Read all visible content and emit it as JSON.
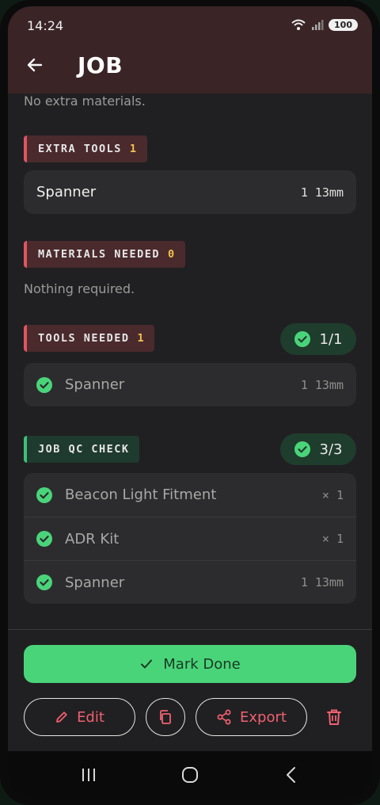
{
  "status": {
    "time": "14:24",
    "battery": "100"
  },
  "header": {
    "title": "JOB"
  },
  "extra_materials": {
    "empty_text": "No extra materials."
  },
  "extra_tools": {
    "label": "EXTRA TOOLS",
    "count": "1",
    "items": [
      {
        "name": "Spanner",
        "qty": "1 13mm"
      }
    ]
  },
  "materials_needed": {
    "label": "MATERIALS NEEDED",
    "count": "0",
    "empty_text": "Nothing required."
  },
  "tools_needed": {
    "label": "TOOLS NEEDED",
    "count": "1",
    "progress": "1/1",
    "items": [
      {
        "name": "Spanner",
        "qty": "1 13mm"
      }
    ]
  },
  "qc_check": {
    "label": "JOB QC CHECK",
    "progress": "3/3",
    "items": [
      {
        "name": "Beacon Light Fitment",
        "qty": "× 1"
      },
      {
        "name": "ADR Kit",
        "qty": "× 1"
      },
      {
        "name": "Spanner",
        "qty": "1 13mm"
      }
    ]
  },
  "actions": {
    "mark_done": "Mark Done",
    "edit": "Edit",
    "export": "Export"
  },
  "colors": {
    "accent_green": "#4ad47a",
    "accent_red": "#f06070",
    "header_bg": "#3a2426"
  }
}
